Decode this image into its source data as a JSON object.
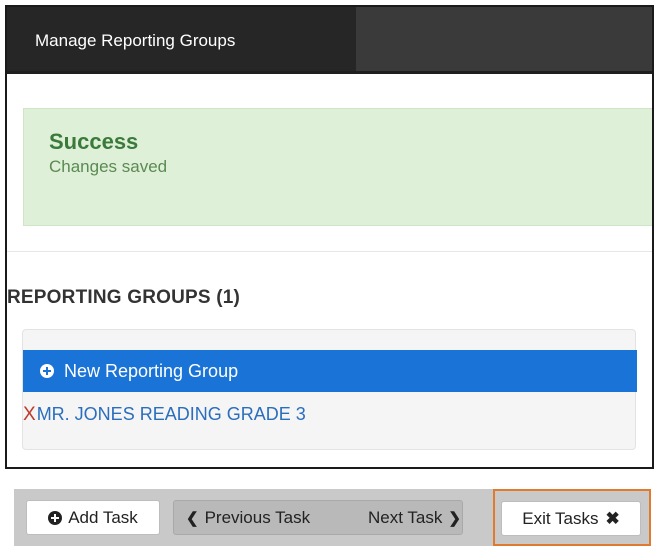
{
  "header": {
    "active_tab": "Manage Reporting Groups"
  },
  "alert": {
    "title": "Success",
    "message": "Changes saved",
    "color": "#dff0d8"
  },
  "section": {
    "heading": "REPORTING GROUPS (1)"
  },
  "groups": {
    "new_button_label": "New Reporting Group",
    "new_button_icon": "plus-circle-icon",
    "items": [
      {
        "remove_icon": "X",
        "name": "MR. JONES READING GRADE 3"
      }
    ]
  },
  "toolbar": {
    "add_task_label": "Add Task",
    "previous_label": "Previous Task",
    "previous_icon": "chevron-left-icon",
    "next_label": "Next Task",
    "next_icon": "chevron-right-icon",
    "exit_label": "Exit Tasks",
    "exit_icon": "✖",
    "highlight_color": "#e07a2e"
  }
}
